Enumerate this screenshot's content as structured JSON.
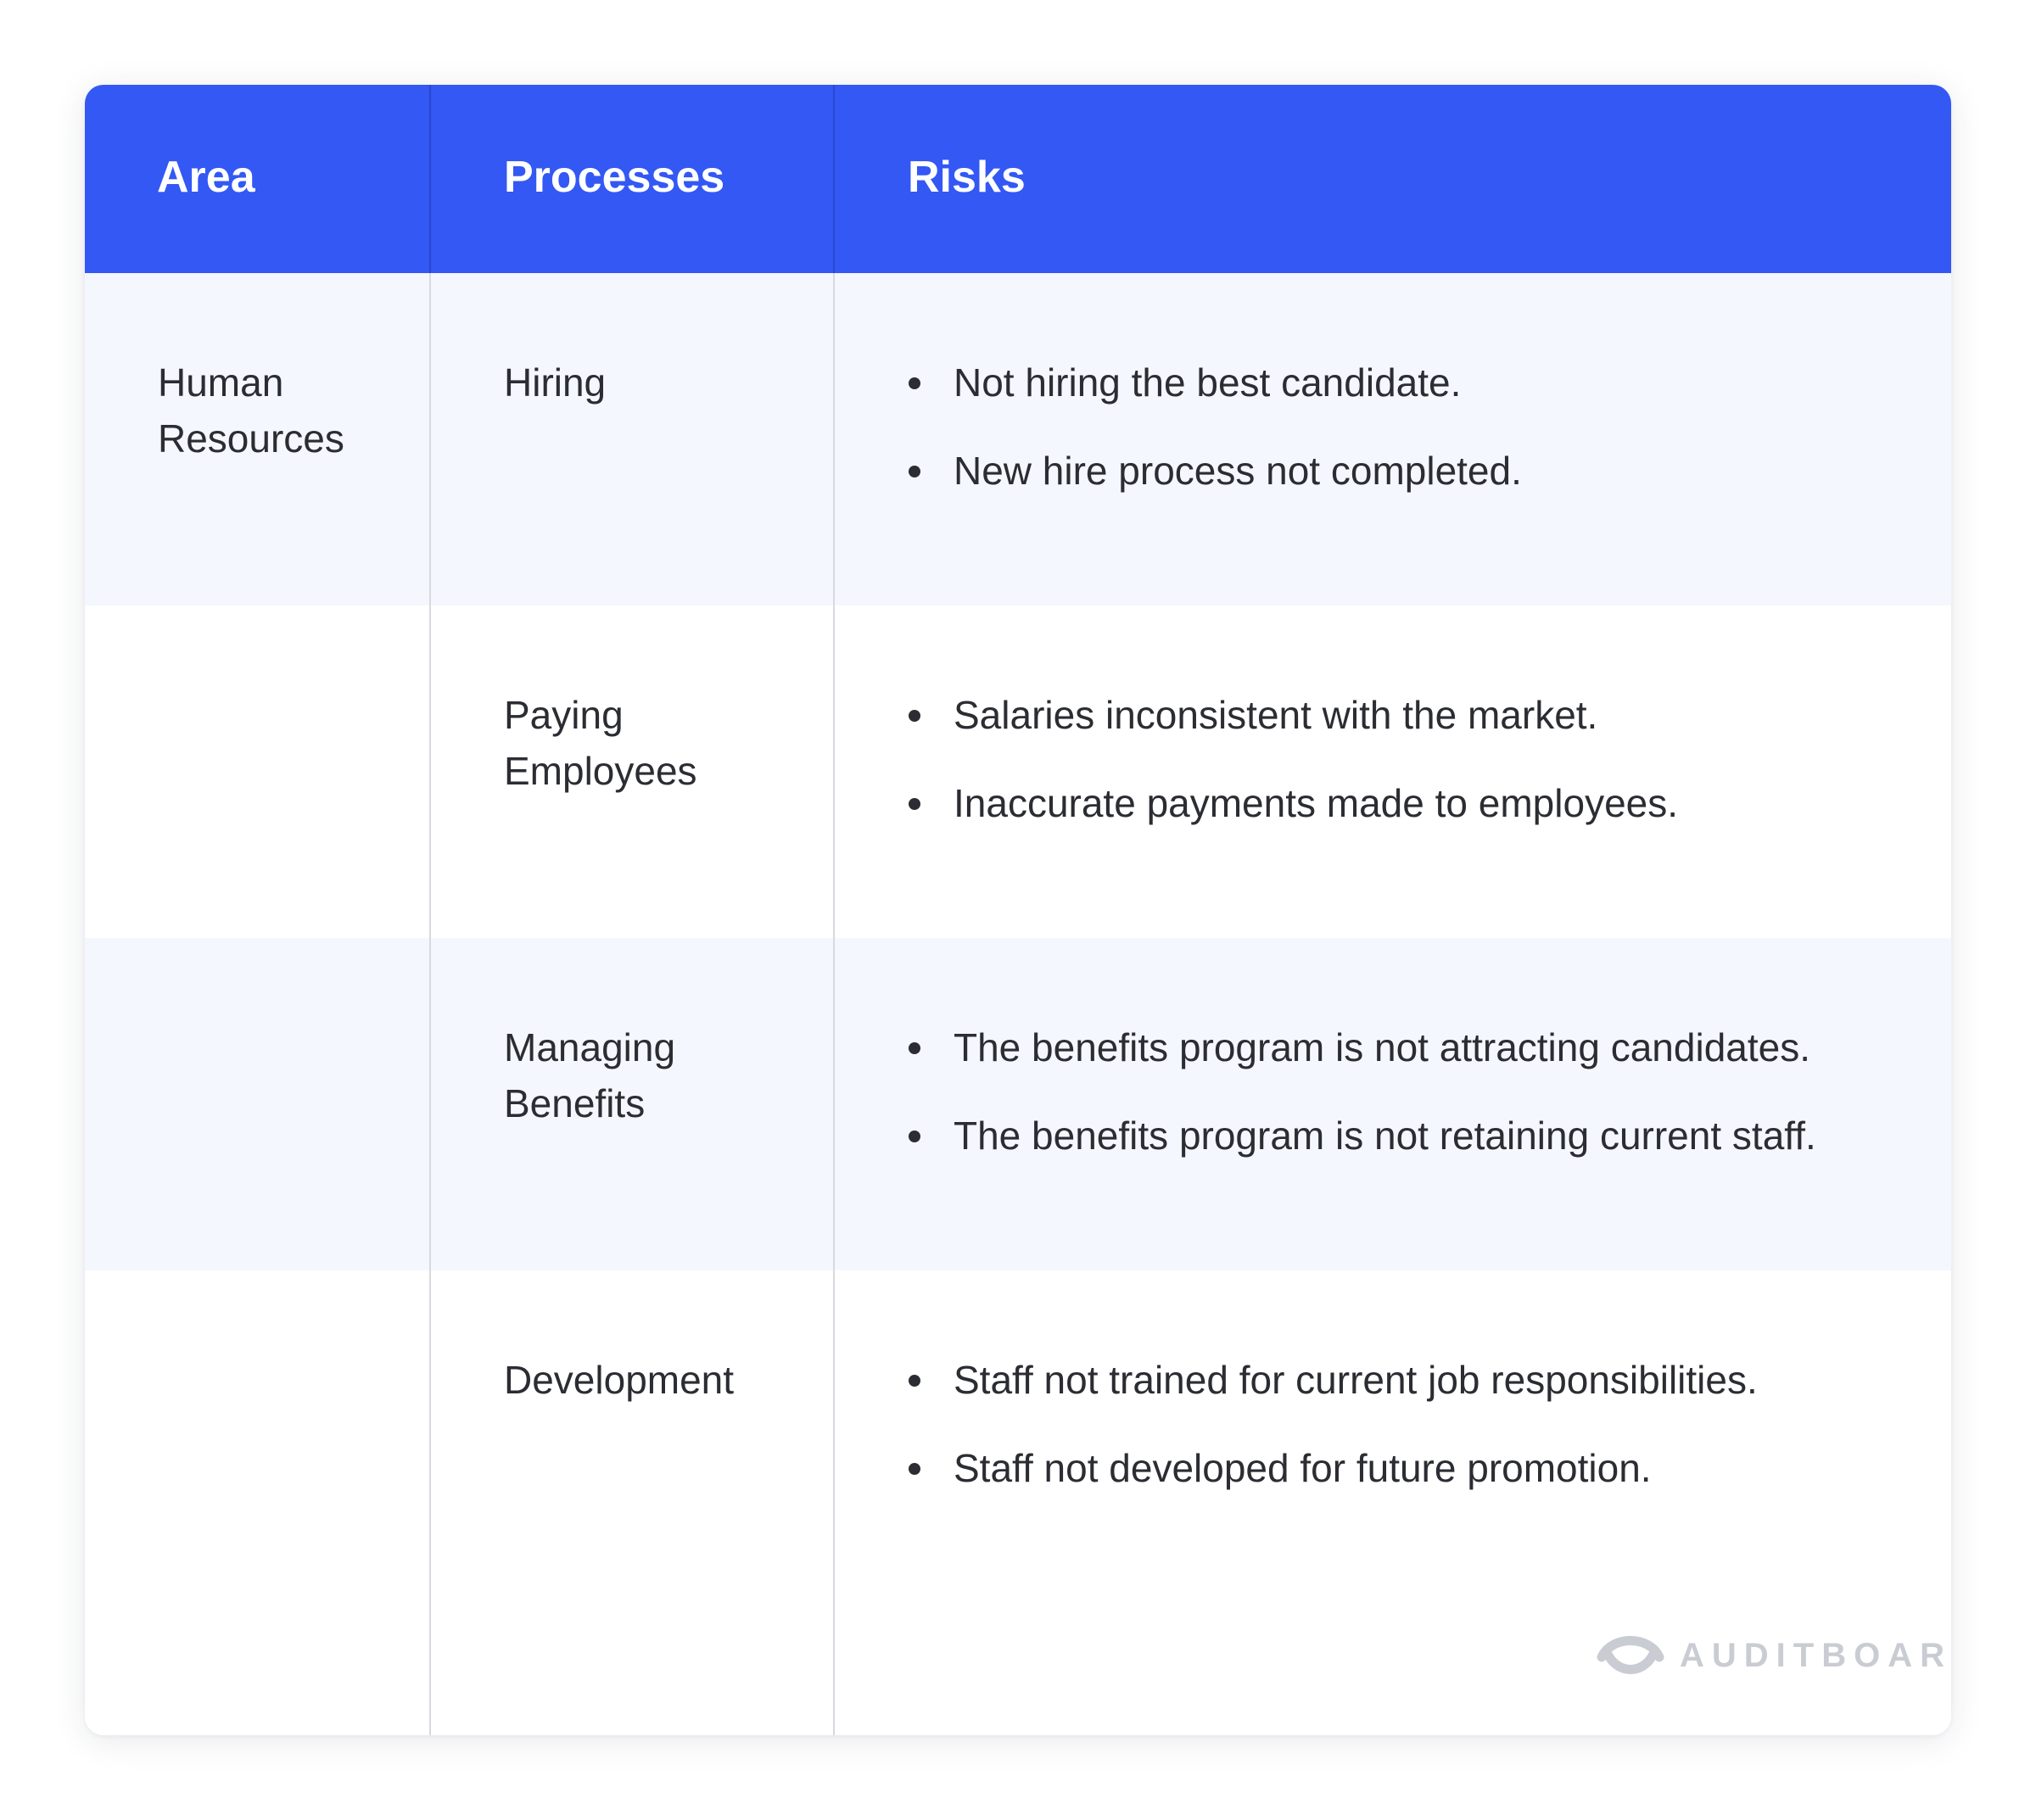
{
  "table": {
    "headers": {
      "area": "Area",
      "processes": "Processes",
      "risks": "Risks"
    },
    "rows": [
      {
        "area": [
          "Human",
          "Resources"
        ],
        "process": [
          "Hiring"
        ],
        "risks": [
          "Not hiring the best candidate.",
          "New hire process not completed."
        ]
      },
      {
        "area": [],
        "process": [
          "Paying",
          "Employees"
        ],
        "risks": [
          "Salaries inconsistent with the market.",
          "Inaccurate payments made to employees."
        ]
      },
      {
        "area": [],
        "process": [
          "Managing",
          "Benefits"
        ],
        "risks": [
          "The benefits program is not attracting candidates.",
          "The benefits program is not retaining current staff."
        ]
      },
      {
        "area": [],
        "process": [
          "Development"
        ],
        "risks": [
          "Staff not trained for current job responsibilities.",
          "Staff not developed for future promotion."
        ]
      }
    ]
  },
  "brand": {
    "name": "AUDITBOARD",
    "icon": "auditboard-logo-icon"
  },
  "colors": {
    "header_bg": "#3358f4",
    "row_shaded": "#f4f7fd",
    "text": "#2b2d33",
    "logo_gray": "#c9ccd2"
  }
}
